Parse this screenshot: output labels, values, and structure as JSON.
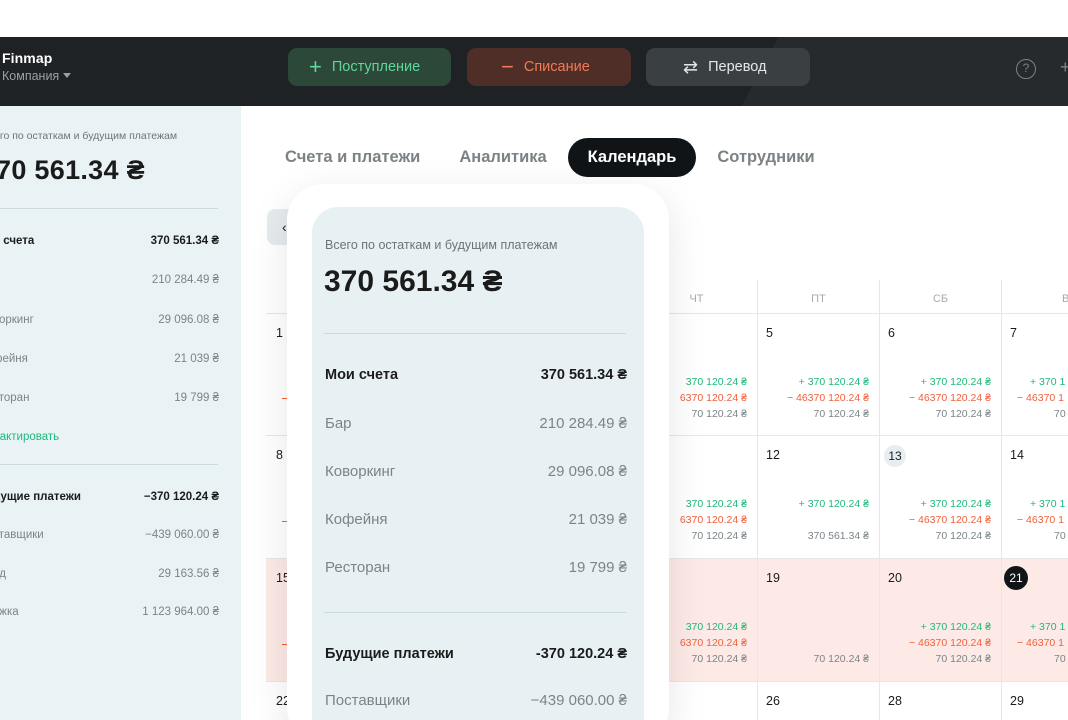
{
  "app": {
    "name": "Finmap",
    "company_label": "Компания"
  },
  "topbar": {
    "income_label": "Поступление",
    "expense_label": "Списание",
    "transfer_label": "Перевод",
    "help_glyph": "?",
    "colors": {
      "income": "#5fd69b",
      "expense": "#f27a56",
      "bar_bg": "#1e2224"
    }
  },
  "sidebar": {
    "caption": "его по остаткам и будущим платежам",
    "total": "70 561.34 ₴",
    "accounts": {
      "label": "и счета",
      "value": "370 561.34 ₴"
    },
    "account_rows": [
      {
        "label": "",
        "value": "210 284.49 ₴"
      },
      {
        "label": "воркинг",
        "value": "29 096.08 ₴"
      },
      {
        "label": "фейня",
        "value": "21 039 ₴"
      },
      {
        "label": "сторан",
        "value": "19 799 ₴"
      }
    ],
    "edit_label": "дактировать",
    "future": {
      "label": "дущие платежи",
      "value": "−370 120.24 ₴"
    },
    "future_rows": [
      {
        "label": "ставщики",
        "value": "−439 060.00 ₴"
      },
      {
        "label": "яд",
        "value": "29 163.56 ₴"
      },
      {
        "label": "ежка",
        "value": "1 123 964.00 ₴"
      }
    ]
  },
  "tabs": [
    "Счета и платежи",
    "Аналитика",
    "Календарь",
    "Сотрудники"
  ],
  "active_tab": "Календарь",
  "back_glyph": "‹",
  "calendar": {
    "weekdays": {
      "thu": "ЧТ",
      "fri": "ПТ",
      "sat": "СБ",
      "sun": "ВС"
    },
    "left_day_numbers": [
      "1",
      "8",
      "15",
      "22"
    ],
    "weeks": [
      {
        "thu": {
          "day": "",
          "lines": [
            "370 120.24 ₴",
            "6370 120.24 ₴",
            "70 120.24 ₴"
          ]
        },
        "fri": {
          "day": "5",
          "lines": [
            "+ 370 120.24 ₴",
            "− 46370 120.24 ₴",
            "70 120.24 ₴"
          ]
        },
        "sat": {
          "day": "6",
          "lines": [
            "+ 370 120.24 ₴",
            "− 46370 120.24 ₴",
            "70 120.24 ₴"
          ]
        },
        "sun": {
          "day": "7",
          "lines": [
            "+ 370 1",
            "− 46370 1",
            "70 1"
          ]
        }
      },
      {
        "thu": {
          "day": "",
          "lines": [
            "370 120.24 ₴",
            "6370 120.24 ₴",
            "70 120.24 ₴"
          ]
        },
        "fri": {
          "day": "12",
          "lines": [
            "+ 370 120.24 ₴",
            "",
            "370 561.34 ₴"
          ]
        },
        "sat": {
          "day": "13",
          "lines": [
            "+ 370 120.24 ₴",
            "− 46370 120.24 ₴",
            "70 120.24 ₴"
          ]
        },
        "sun": {
          "day": "14",
          "lines": [
            "+ 370 1",
            "− 46370 1",
            "70 1"
          ]
        }
      },
      {
        "thu": {
          "day": "",
          "lines": [
            "370 120.24 ₴",
            "6370 120.24 ₴",
            "70 120.24 ₴"
          ]
        },
        "fri": {
          "day": "19",
          "lines": [
            "",
            "",
            "70 120.24 ₴"
          ]
        },
        "sat": {
          "day": "20",
          "lines": [
            "+ 370 120.24 ₴",
            "− 46370 120.24 ₴",
            "70 120.24 ₴"
          ]
        },
        "sun": {
          "day": "21",
          "lines": [
            "+ 370 1",
            "− 46370 1",
            "70 1"
          ]
        }
      },
      {
        "thu": {
          "day": "",
          "lines": [
            "",
            "",
            ""
          ]
        },
        "fri": {
          "day": "26",
          "lines": [
            "",
            "",
            ""
          ]
        },
        "sat": {
          "day": "28",
          "lines": [
            "",
            "",
            ""
          ]
        },
        "sun": {
          "day": "29",
          "lines": [
            "",
            "",
            ""
          ]
        }
      }
    ]
  },
  "card": {
    "caption": "Всего по остаткам и будущим платежам",
    "total": "370 561.34 ₴",
    "accounts": {
      "label": "Мои счета",
      "value": "370 561.34 ₴"
    },
    "account_rows": [
      {
        "label": "Бар",
        "value": "210 284.49 ₴"
      },
      {
        "label": "Коворкинг",
        "value": "29 096.08 ₴"
      },
      {
        "label": "Кофейня",
        "value": "21 039 ₴"
      },
      {
        "label": "Ресторан",
        "value": "19 799 ₴"
      }
    ],
    "future": {
      "label": "Будущие платежи",
      "value": "-370 120.24 ₴"
    },
    "future_rows": [
      {
        "label": "Поставщики",
        "value": "−439 060.00 ₴"
      }
    ]
  }
}
